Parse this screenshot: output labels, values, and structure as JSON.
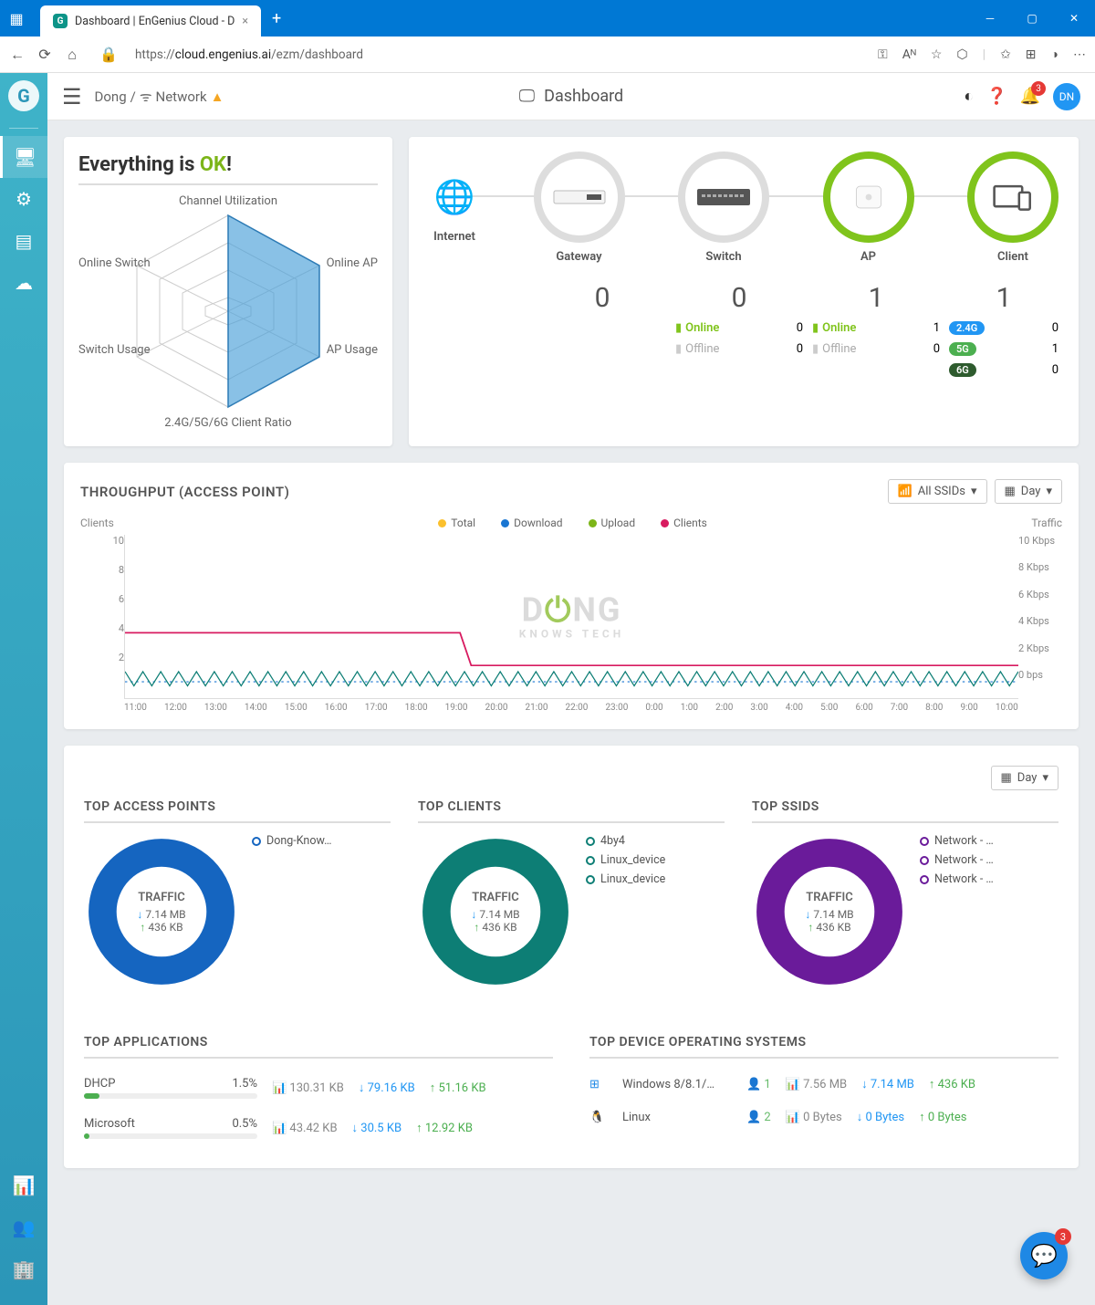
{
  "browser": {
    "tab_title": "Dashboard | EnGenius Cloud - D",
    "url_host": "cloud.engenius.ai",
    "url_prefix": "https://",
    "url_path": "/ezm/dashboard"
  },
  "header": {
    "breadcrumb_user": "Dong",
    "breadcrumb_net": "Network",
    "page_title": "Dashboard",
    "notification_count": "3",
    "avatar": "DN"
  },
  "status": {
    "heading_pre": "Everything is ",
    "heading_ok": "OK",
    "heading_post": "!",
    "radar_labels": {
      "top": "Channel Utilization",
      "tr": "Online AP",
      "br": "AP Usage",
      "bottom": "2.4G/5G/6G Client Ratio",
      "bl": "Switch Usage",
      "tl": "Online Switch"
    }
  },
  "topology": {
    "nodes": [
      "Internet",
      "Gateway",
      "Switch",
      "AP",
      "Client"
    ],
    "gateway": {
      "count": "0",
      "online": "0",
      "offline": "0"
    },
    "switch": {
      "count": "0"
    },
    "ap": {
      "count": "1",
      "online": "1",
      "offline": "0"
    },
    "client": {
      "count": "1",
      "b24": "0",
      "b5": "1",
      "b6": "0"
    }
  },
  "throughput": {
    "title": "THROUGHPUT (ACCESS POINT)",
    "ssid_dd": "All SSIDs",
    "period_dd": "Day",
    "left_label": "Clients",
    "right_label": "Traffic",
    "legend": [
      "Total",
      "Download",
      "Upload",
      "Clients"
    ],
    "legend_colors": [
      "#fbc02d",
      "#1976d2",
      "#7cb518",
      "#d81b60"
    ],
    "y_left": [
      "10",
      "8",
      "6",
      "4",
      "2",
      ""
    ],
    "y_right": [
      "10 Kbps",
      "8 Kbps",
      "6 Kbps",
      "4 Kbps",
      "2 Kbps",
      "0 bps"
    ],
    "x": [
      "11:00",
      "12:00",
      "13:00",
      "14:00",
      "15:00",
      "16:00",
      "17:00",
      "18:00",
      "19:00",
      "20:00",
      "21:00",
      "22:00",
      "23:00",
      "0:00",
      "1:00",
      "2:00",
      "3:00",
      "4:00",
      "5:00",
      "6:00",
      "7:00",
      "8:00",
      "9:00",
      "10:00"
    ]
  },
  "tops": {
    "period_dd": "Day",
    "cols": [
      {
        "title": "TOP ACCESS POINTS",
        "color": "#1565c0",
        "legend": [
          "Dong-Know…"
        ]
      },
      {
        "title": "TOP CLIENTS",
        "color": "#0d7e75",
        "legend": [
          "4by4",
          "Linux_device",
          "Linux_device"
        ]
      },
      {
        "title": "TOP SSIDS",
        "color": "#6a1b9a",
        "legend": [
          "Network - …",
          "Network - …",
          "Network - …"
        ]
      }
    ],
    "traffic_label": "TRAFFIC",
    "down": "7.14 MB",
    "up": "436 KB"
  },
  "apps": {
    "title_left": "TOP APPLICATIONS",
    "title_right": "TOP DEVICE OPERATING SYSTEMS",
    "rows": [
      {
        "name": "DHCP",
        "pct": "1.5%",
        "total": "130.31 KB",
        "down": "79.16 KB",
        "up": "51.16 KB"
      },
      {
        "name": "Microsoft",
        "pct": "0.5%",
        "total": "43.42 KB",
        "down": "30.5 KB",
        "up": "12.92 KB"
      }
    ],
    "os_rows": [
      {
        "name": "Windows 8/8.1/…",
        "clients": "1",
        "total": "7.56 MB",
        "down": "7.14 MB",
        "up": "436 KB"
      },
      {
        "name": "Linux",
        "clients": "2",
        "total": "0 Bytes",
        "down": "0 Bytes",
        "up": "0 Bytes"
      }
    ]
  },
  "fab_badge": "3",
  "chart_data": {
    "type": "line",
    "title": "THROUGHPUT (ACCESS POINT)",
    "x": [
      "11:00",
      "12:00",
      "13:00",
      "14:00",
      "15:00",
      "16:00",
      "17:00",
      "18:00",
      "19:00",
      "20:00",
      "21:00",
      "22:00",
      "23:00",
      "0:00",
      "1:00",
      "2:00",
      "3:00",
      "4:00",
      "5:00",
      "6:00",
      "7:00",
      "8:00",
      "9:00",
      "10:00"
    ],
    "y_left_label": "Clients",
    "y_left_range": [
      0,
      10
    ],
    "y_right_label": "Traffic",
    "y_right_range_kbps": [
      0,
      10
    ],
    "series": [
      {
        "name": "Total",
        "axis": "right",
        "values": [
          1,
          1,
          1,
          1,
          1,
          1,
          1,
          1,
          1,
          1,
          1,
          1,
          1,
          1,
          1,
          1,
          1,
          1,
          1,
          1,
          1,
          1,
          1,
          1
        ]
      },
      {
        "name": "Download",
        "axis": "right",
        "values": [
          0.8,
          0.8,
          0.8,
          0.8,
          0.8,
          0.8,
          0.8,
          0.8,
          0.8,
          0.8,
          0.8,
          0.8,
          0.8,
          0.8,
          0.8,
          0.8,
          0.8,
          0.8,
          0.8,
          0.8,
          0.8,
          0.8,
          0.8,
          0.8
        ]
      },
      {
        "name": "Upload",
        "axis": "right",
        "values": [
          0.2,
          0.2,
          0.2,
          0.2,
          0.2,
          0.2,
          0.2,
          0.2,
          0.2,
          0.2,
          0.2,
          0.2,
          0.2,
          0.2,
          0.2,
          0.2,
          0.2,
          0.2,
          0.2,
          0.2,
          0.2,
          0.2,
          0.2,
          0.2
        ]
      },
      {
        "name": "Clients",
        "axis": "left",
        "values": [
          3,
          3,
          3,
          3,
          3,
          3,
          3,
          3,
          3,
          1,
          1,
          1,
          1,
          1,
          1,
          1,
          1,
          1,
          1,
          1,
          1,
          1,
          1,
          1
        ]
      }
    ]
  }
}
